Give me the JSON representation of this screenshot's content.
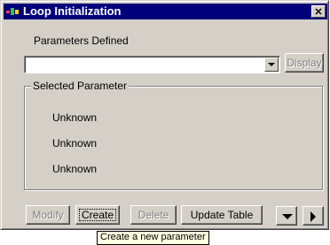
{
  "window": {
    "title": "Loop Initialization",
    "close_glyph": "✕"
  },
  "parameters": {
    "label": "Parameters Defined",
    "combo_value": "",
    "display_label": "Display"
  },
  "selected_parameter": {
    "group_label": "Selected Parameter",
    "values": [
      "Unknown",
      "Unknown",
      "Unknown"
    ]
  },
  "toolbar": {
    "modify_label": "Modify",
    "create_label": "Create",
    "delete_label": "Delete",
    "update_table_label": "Update Table"
  },
  "tooltip": {
    "text": "Create a new parameter"
  },
  "colors": {
    "title_bar": "#00007b",
    "face": "#d4d0c8",
    "tooltip_bg": "#ffffe1"
  }
}
